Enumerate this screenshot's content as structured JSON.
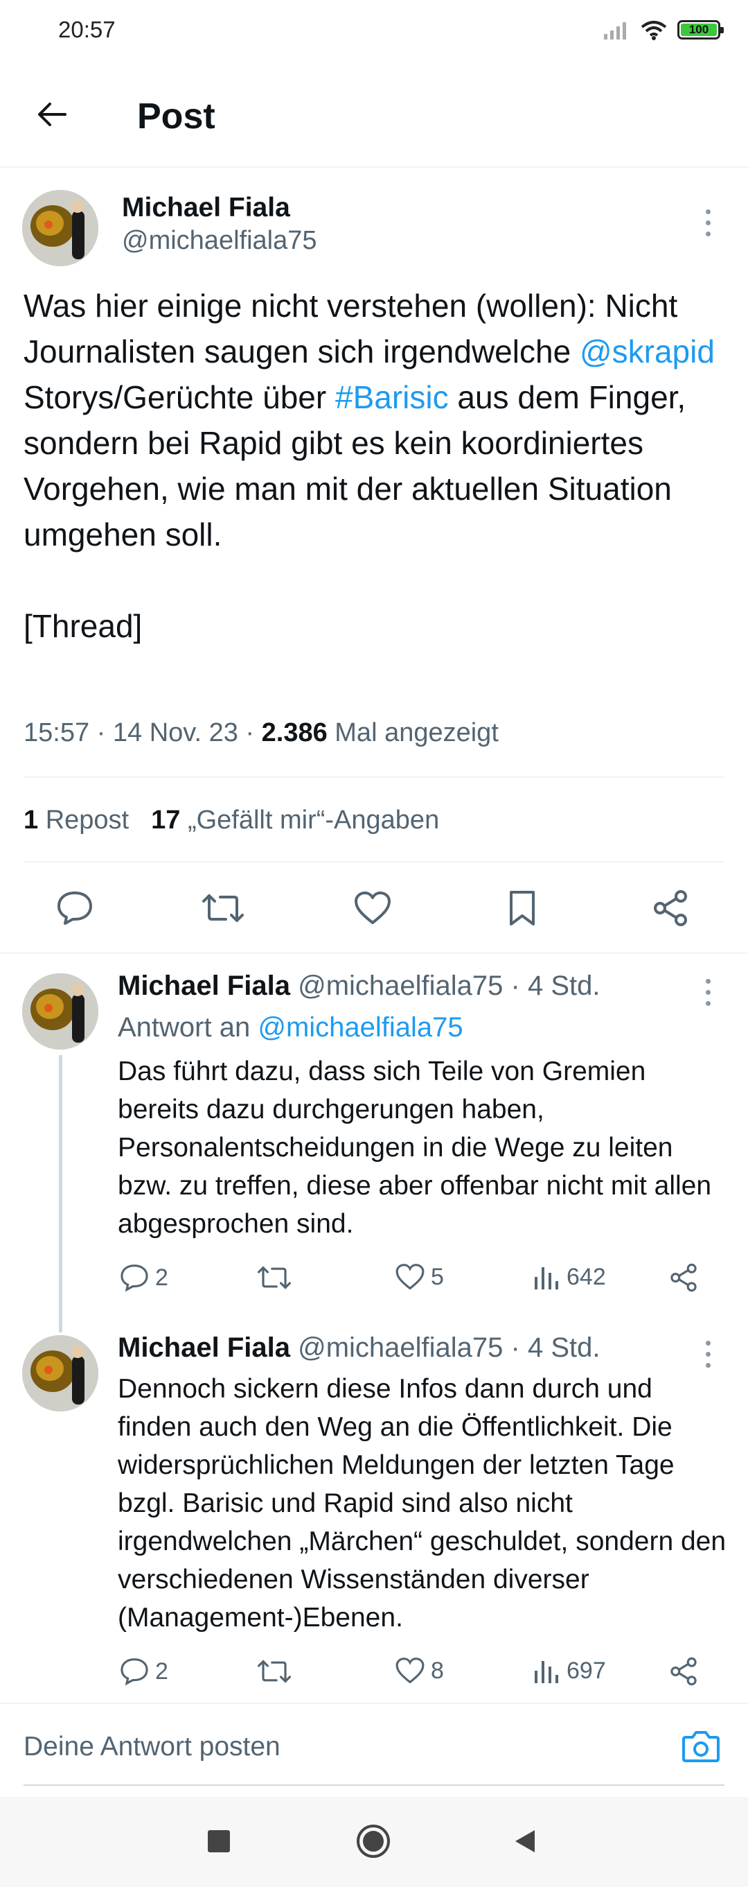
{
  "status_bar": {
    "time": "20:57",
    "battery": "100"
  },
  "header": {
    "title": "Post"
  },
  "tweet": {
    "name": "Michael Fiala",
    "handle": "@michaelfiala75",
    "text_parts": {
      "p1": "Was hier einige nicht verstehen (wollen): Nicht Journalisten saugen sich irgendwelche ",
      "mention": "@skrapid",
      "p2": " Storys/Gerüchte über ",
      "hashtag": "#Barisic",
      "p3": " aus dem Finger, sondern bei Rapid gibt es kein koordiniertes Vorgehen, wie man mit der aktuellen Situation umgehen soll.",
      "p4": "[Thread]"
    },
    "time": "15:57",
    "date": "14 Nov. 23",
    "views_count": "2.386",
    "views_label": "Mal angezeigt",
    "reposts_count": "1",
    "reposts_label": "Repost",
    "likes_count": "17",
    "likes_label": "„Gefällt mir“-Angaben"
  },
  "replies": [
    {
      "name": "Michael Fiala",
      "handle": "@michaelfiala75",
      "age": "· 4 Std.",
      "reply_to_label": "Antwort an",
      "reply_to_handle": "@michaelfiala75",
      "text": "Das führt dazu, dass sich Teile von Gremien bereits dazu durchgerungen haben, Personalentscheidungen in die Wege zu leiten bzw. zu treffen, diese aber offenbar nicht mit allen abgesprochen sind.",
      "replies": "2",
      "likes": "5",
      "views": "642"
    },
    {
      "name": "Michael Fiala",
      "handle": "@michaelfiala75",
      "age": "· 4 Std.",
      "text": "Dennoch sickern diese Infos dann durch und finden auch den Weg an die Öffentlichkeit. Die widersprüchlichen Meldungen der letzten Tage bzgl. Barisic und Rapid sind also nicht irgendwelchen „Märchen“ geschuldet, sondern den verschiedenen Wissenständen diverser (Management-)Ebenen.",
      "replies": "2",
      "likes": "8",
      "views": "697"
    }
  ],
  "compose": {
    "placeholder": "Deine Antwort posten"
  },
  "colors": {
    "accent": "#1d9bf0",
    "muted": "#536471",
    "text": "#0f1419",
    "divider": "#eff3f4"
  }
}
